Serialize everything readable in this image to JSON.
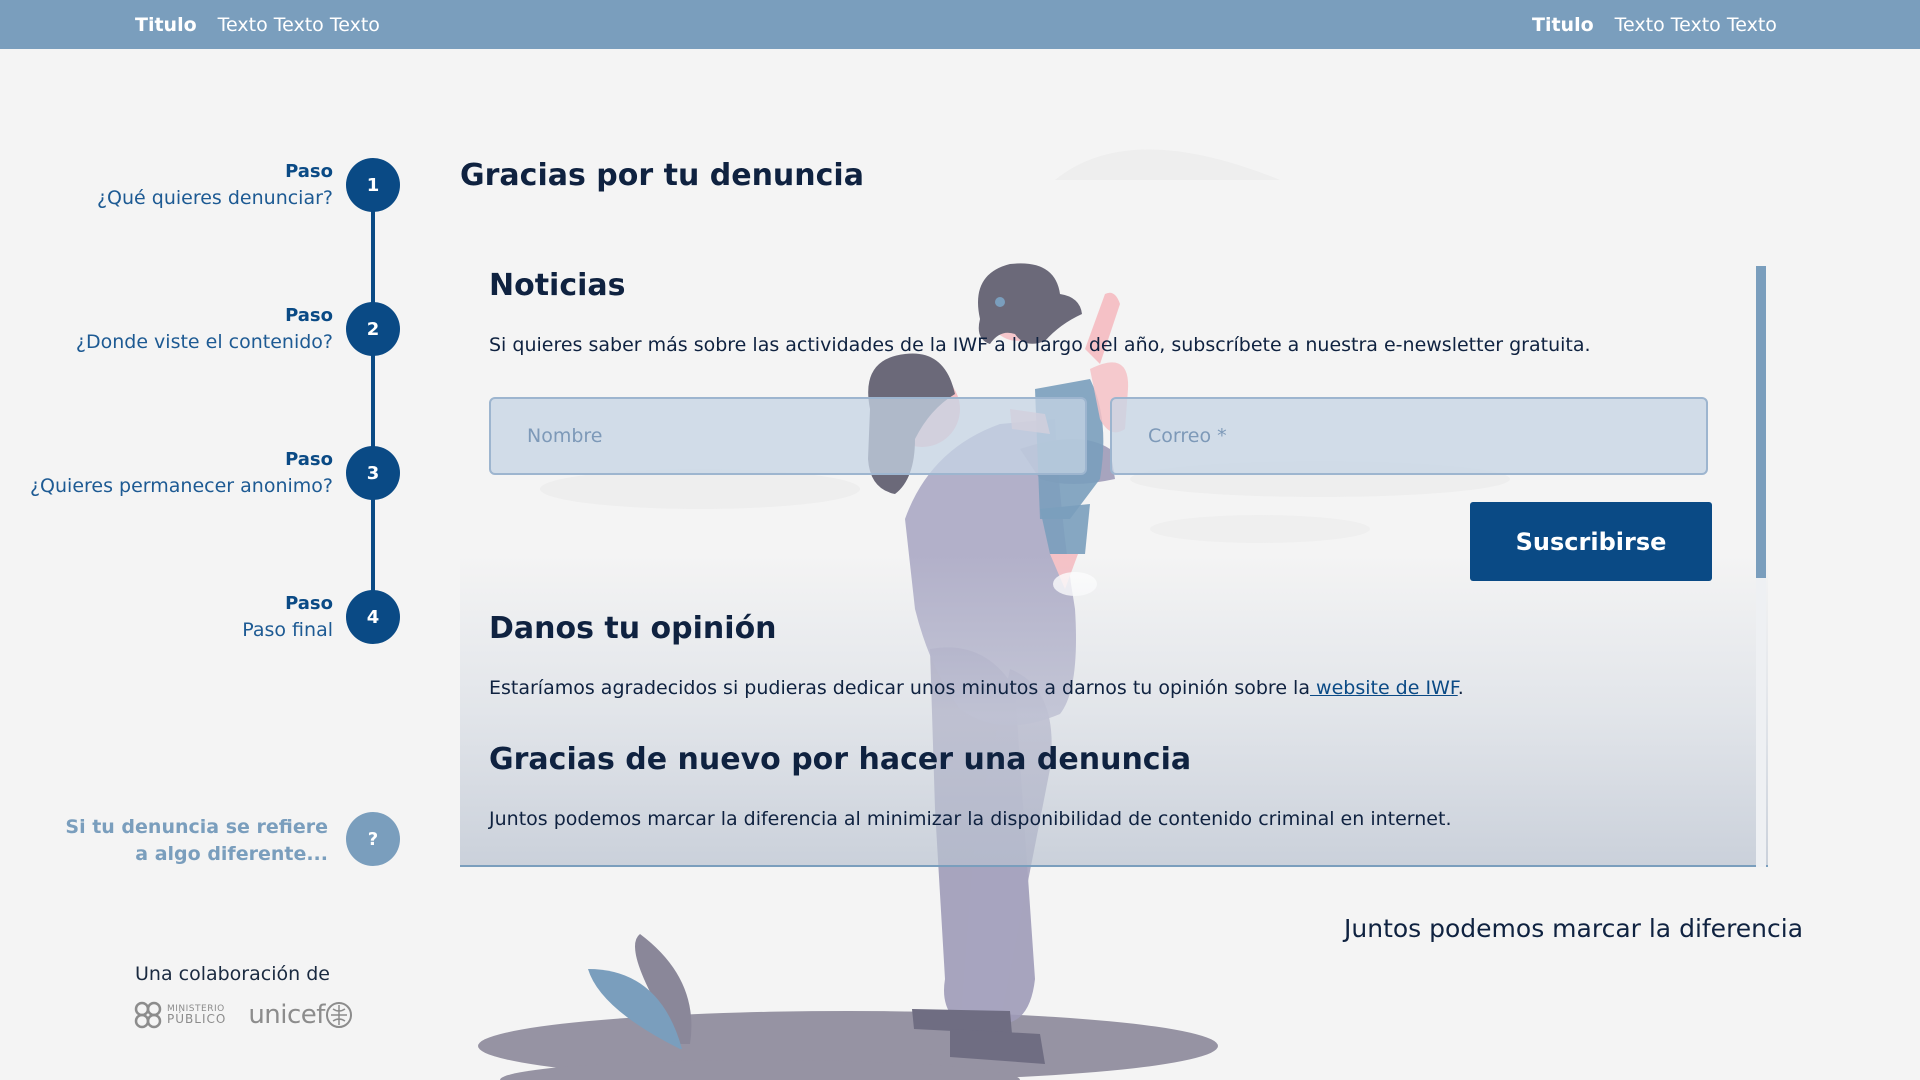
{
  "topbar": {
    "left": {
      "title": "Titulo",
      "text": "Texto Texto Texto"
    },
    "right": {
      "title": "Titulo",
      "text": "Texto Texto Texto"
    }
  },
  "steps": [
    {
      "number": "1",
      "label": "Paso",
      "text": "¿Qué quieres denunciar?"
    },
    {
      "number": "2",
      "label": "Paso",
      "text": "¿Donde viste el contenido?"
    },
    {
      "number": "3",
      "label": "Paso",
      "text": "¿Quieres permanecer anonimo?"
    },
    {
      "number": "4",
      "label": "Paso",
      "text": "Paso final"
    }
  ],
  "help": {
    "symbol": "?",
    "line1": "Si tu denuncia se refiere",
    "line2": "a algo diferente..."
  },
  "collab": {
    "label": "Una colaboración de",
    "ministerio_line1": "MINISTERIO",
    "ministerio_line2": "PÚBLICO",
    "unicef": "unicef"
  },
  "main": {
    "title": "Gracias por tu denuncia",
    "news": {
      "heading": "Noticias",
      "text": "Si quieres saber más sobre las actividades de la IWF a lo largo del año, subscríbete a nuestra e-newsletter gratuita.",
      "name_placeholder": "Nombre",
      "email_placeholder": "Correo *",
      "subscribe_label": "Suscribirse"
    },
    "opinion": {
      "heading": "Danos tu opinión",
      "text_before": "Estaríamos agradecidos si pudieras dedicar unos minutos a darnos tu opinión sobre la",
      "link": " website de IWF",
      "text_after": "."
    },
    "thanks": {
      "heading": "Gracias de nuevo por hacer una denuncia",
      "text": "Juntos podemos marcar la diferencia al minimizar la disponibilidad de contenido criminal en internet."
    },
    "slogan": "Juntos podemos marcar la diferencia"
  },
  "colors": {
    "topbar": "#7a9ebd",
    "primary": "#0a4a85",
    "background": "#f4f4f4",
    "text": "#0f2240"
  }
}
